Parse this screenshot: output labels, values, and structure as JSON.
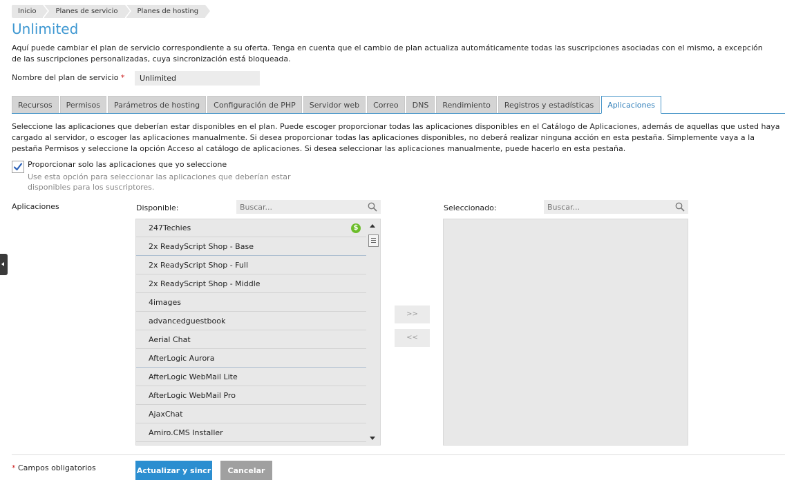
{
  "breadcrumb": [
    "Inicio",
    "Planes de servicio",
    "Planes de hosting"
  ],
  "page": {
    "title": "Unlimited",
    "intro": "Aquí puede cambiar el plan de servicio correspondiente a su oferta. Tenga en cuenta que el cambio de plan actualiza automáticamente todas las suscripciones asociadas con el mismo, a excepción de las suscripciones personalizadas, cuya sincronización está bloqueada."
  },
  "plan_name": {
    "label": "Nombre del plan de servicio",
    "required_mark": "*",
    "value": "Unlimited"
  },
  "tabs": [
    {
      "label": "Recursos",
      "active": false
    },
    {
      "label": "Permisos",
      "active": false
    },
    {
      "label": "Parámetros de hosting",
      "active": false
    },
    {
      "label": "Configuración de PHP",
      "active": false
    },
    {
      "label": "Servidor web",
      "active": false
    },
    {
      "label": "Correo",
      "active": false
    },
    {
      "label": "DNS",
      "active": false
    },
    {
      "label": "Rendimiento",
      "active": false
    },
    {
      "label": "Registros y estadísticas",
      "active": false
    },
    {
      "label": "Aplicaciones",
      "active": true
    }
  ],
  "applications_tab": {
    "description": "Seleccione las aplicaciones que deberían estar disponibles en el plan. Puede escoger proporcionar todas las aplicaciones disponibles en el Catálogo de Aplicaciones, además de aquellas que usted haya cargado al servidor, o escoger las aplicaciones manualmente. Si desea proporcionar todas las aplicaciones disponibles, no deberá realizar ninguna acción en esta pestaña. Simplemente vaya a la pestaña Permisos y seleccione la opción Acceso al catálogo de aplicaciones. Si desea seleccionar las aplicaciones manualmente, puede hacerlo en esta pestaña.",
    "only_selected": {
      "label": "Proporcionar solo las aplicaciones que yo seleccione",
      "checked": true,
      "hint": "Use esta opción para seleccionar las aplicaciones que deberían estar disponibles para los suscriptores."
    },
    "apps_label": "Aplicaciones",
    "available": {
      "label": "Disponible:",
      "search_placeholder": "Buscar...",
      "items": [
        {
          "name": "247Techies",
          "paid": true
        },
        {
          "name": "2x ReadyScript Shop - Base",
          "paid": false
        },
        {
          "name": "2x ReadyScript Shop - Full",
          "paid": false
        },
        {
          "name": "2x ReadyScript Shop - Middle",
          "paid": false
        },
        {
          "name": "4images",
          "paid": false
        },
        {
          "name": "advancedguestbook",
          "paid": false
        },
        {
          "name": "Aerial Chat",
          "paid": false
        },
        {
          "name": "AfterLogic Aurora",
          "paid": false
        },
        {
          "name": "AfterLogic WebMail Lite",
          "paid": false
        },
        {
          "name": "AfterLogic WebMail Pro",
          "paid": false
        },
        {
          "name": "AjaxChat",
          "paid": false
        },
        {
          "name": "Amiro.CMS Installer",
          "paid": false
        }
      ]
    },
    "selected": {
      "label": "Seleccionado:",
      "search_placeholder": "Buscar...",
      "items": []
    },
    "add_button": ">>",
    "remove_button": "<<"
  },
  "footer": {
    "required_mark": "*",
    "required_note": "Campos obligatorios",
    "submit_label": "Actualizar y sincr",
    "cancel_label": "Cancelar"
  },
  "colors": {
    "title": "#3d97d1",
    "primary_button": "#2b8ed0",
    "secondary_button": "#a0a0a0",
    "paid_badge": "#6cbd2a",
    "active_tab_border": "#4a97c9"
  },
  "icons": [
    "search-icon",
    "check-icon",
    "dollar-icon",
    "collapse-arrow-icon"
  ]
}
